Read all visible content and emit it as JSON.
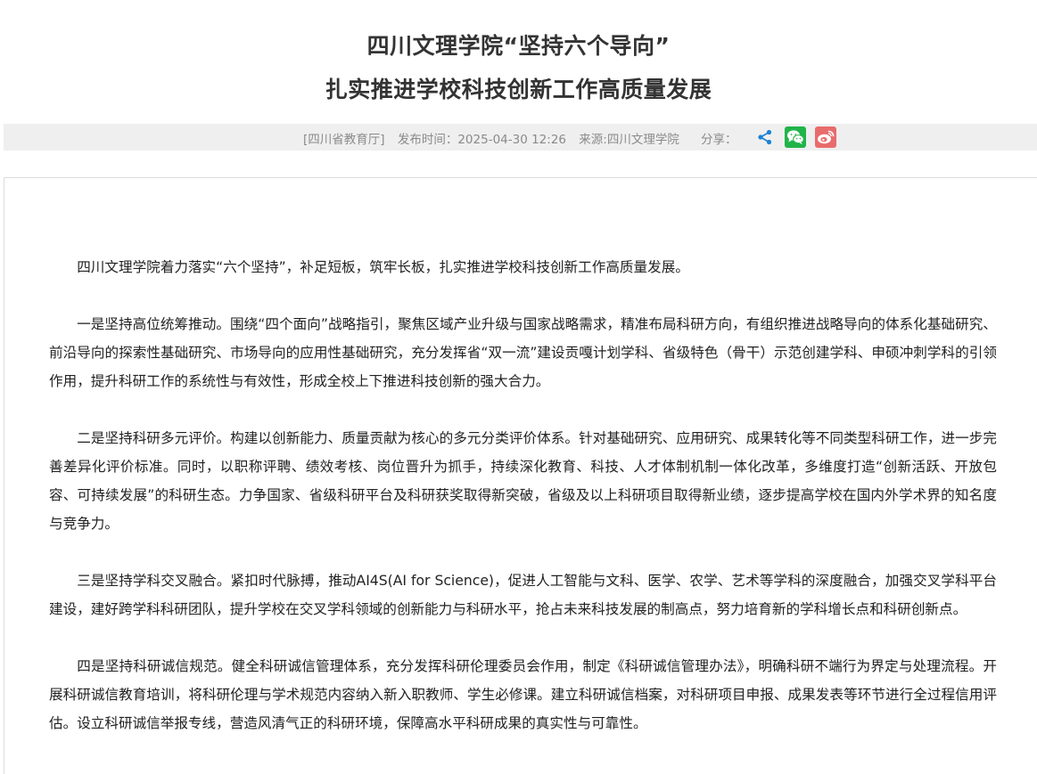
{
  "article": {
    "title_line1": "四川文理学院“坚持六个导向”",
    "title_line2": "扎实推进学校科技创新工作高质量发展",
    "meta": {
      "publisher": "[四川省教育厅]",
      "publish_time": "发布时间：2025-04-30 12:26",
      "source": "来源:四川文理学院",
      "share_label": "分享："
    },
    "share_icons": [
      "share-icon",
      "wechat-icon",
      "weibo-icon"
    ],
    "colors": {
      "wechat": "#20b44a",
      "weibo": "#e96c6c",
      "share": "#1a82d6",
      "meta_bar_bg": "#efefef"
    },
    "paragraphs": [
      "四川文理学院着力落实“六个坚持”，补足短板，筑牢长板，扎实推进学校科技创新工作高质量发展。",
      "一是坚持高位统筹推动。围绕“四个面向”战略指引，聚焦区域产业升级与国家战略需求，精准布局科研方向，有组织推进战略导向的体系化基础研究、前沿导向的探索性基础研究、市场导向的应用性基础研究，充分发挥省“双一流”建设贡嘎计划学科、省级特色（骨干）示范创建学科、申硕冲刺学科的引领作用，提升科研工作的系统性与有效性，形成全校上下推进科技创新的强大合力。",
      "二是坚持科研多元评价。构建以创新能力、质量贡献为核心的多元分类评价体系。针对基础研究、应用研究、成果转化等不同类型科研工作，进一步完善差异化评价标准。同时，以职称评聘、绩效考核、岗位晋升为抓手，持续深化教育、科技、人才体制机制一体化改革，多维度打造“创新活跃、开放包容、可持续发展”的科研生态。力争国家、省级科研平台及科研获奖取得新突破，省级及以上科研项目取得新业绩，逐步提高学校在国内外学术界的知名度与竞争力。",
      "三是坚持学科交叉融合。紧扣时代脉搏，推动AI4S(AI for Science)，促进人工智能与文科、医学、农学、艺术等学科的深度融合，加强交叉学科平台建设，建好跨学科科研团队，提升学校在交叉学科领域的创新能力与科研水平，抢占未来科技发展的制高点，努力培育新的学科增长点和科研创新点。",
      "四是坚持科研诚信规范。健全科研诚信管理体系，充分发挥科研伦理委员会作用，制定《科研诚信管理办法》，明确科研不端行为界定与处理流程。开展科研诚信教育培训，将科研伦理与学术规范内容纳入新入职教师、学生必修课。建立科研诚信档案，对科研项目申报、成果发表等环节进行全过程信用评估。设立科研诚信举报专线，营造风清气正的科研环境，保障高水平科研成果的真实性与可靠性。"
    ]
  }
}
